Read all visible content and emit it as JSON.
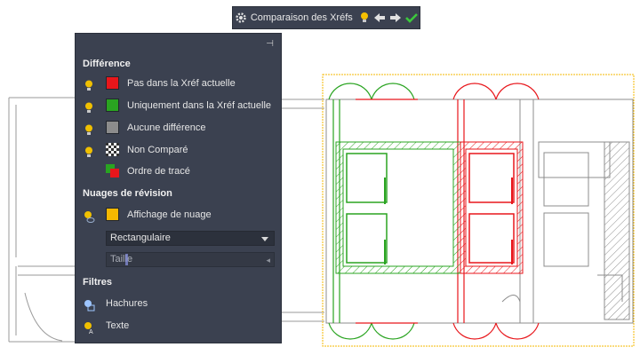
{
  "toolbar": {
    "title": "Comparaison des Xréfs",
    "icons": [
      "gear-icon",
      "lightbulb-icon",
      "arrow-left-icon",
      "arrow-right-icon",
      "checkmark-icon"
    ]
  },
  "palette": {
    "sections": {
      "difference": "Différence",
      "revision_clouds": "Nuages de révision",
      "filters": "Filtres"
    },
    "difference_items": [
      {
        "label": "Pas dans la Xréf actuelle",
        "color": "#e8161b"
      },
      {
        "label": "Uniquement dans la Xréf actuelle",
        "color": "#2aa421"
      },
      {
        "label": "Aucune différence",
        "color": "#8c8c8c"
      },
      {
        "label": "Non Comparé",
        "pattern": "checker"
      },
      {
        "label": "Ordre de tracé",
        "pattern": "red-green"
      }
    ],
    "cloud": {
      "label": "Affichage de nuage",
      "color": "#f5b800",
      "shape_value": "Rectangulaire",
      "size_placeholder": "Taille"
    },
    "filters": {
      "hatches": "Hachures",
      "text": "Texte"
    }
  },
  "colors": {
    "palette_bg": "#3b4150",
    "red": "#e8161b",
    "green": "#2aa421",
    "gray": "#8c8c8c",
    "yellow": "#f5b800"
  }
}
